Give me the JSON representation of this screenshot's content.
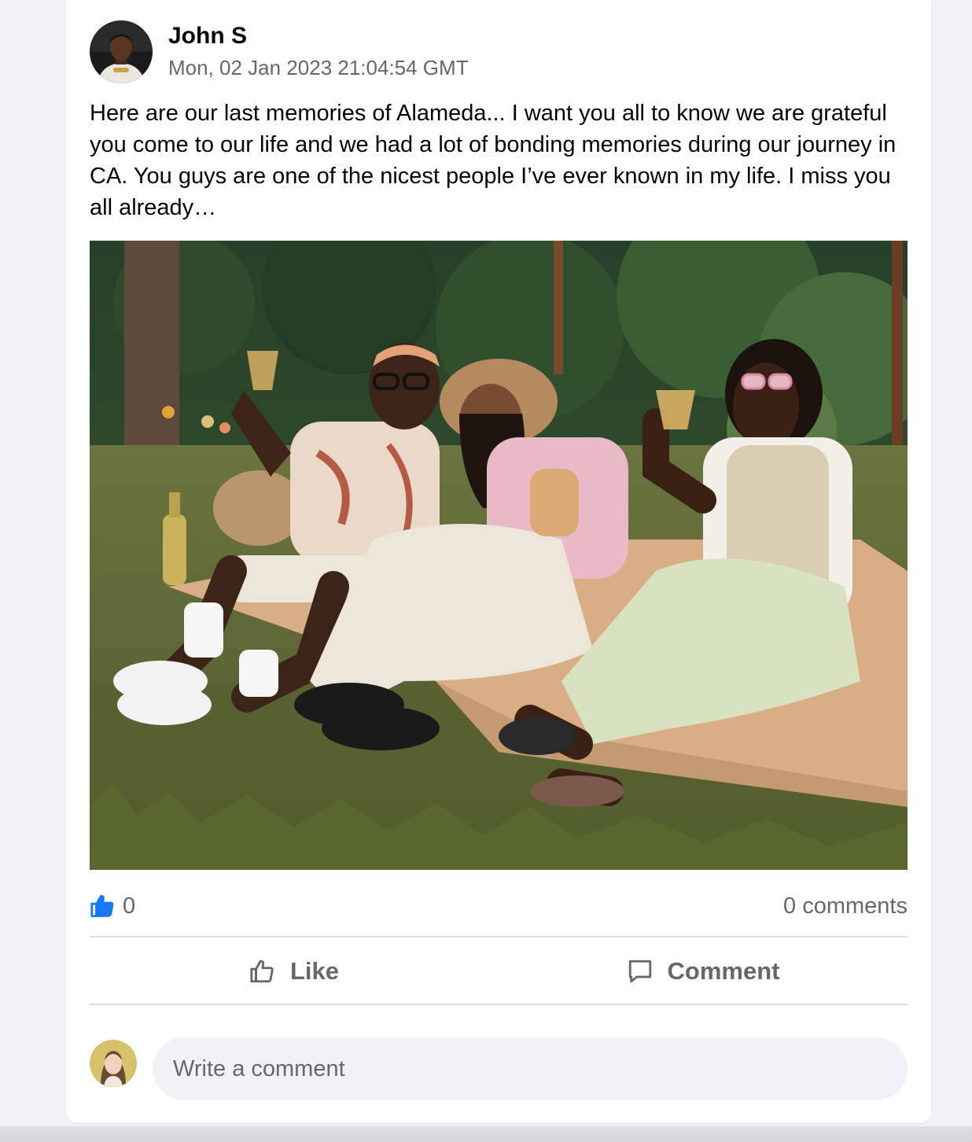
{
  "post": {
    "author": "John S",
    "timestamp": "Mon, 02 Jan 2023 21:04:54 GMT",
    "text": "Here are our last memories of Alameda... I want you all to know we are grateful you come to our life and we had a lot of bonding memories during our journey in CA. You guys are one of the nicest people I’ve ever known in my life. I miss you all already…",
    "photo_icon": "group-picnic-photo"
  },
  "stats": {
    "like_count": "0",
    "comment_count": "0 comments",
    "like_icon": "thumbs-up-icon"
  },
  "actions": {
    "like_label": "Like",
    "like_icon": "thumbs-up-outline-icon",
    "comment_label": "Comment",
    "comment_icon": "speech-bubble-icon"
  },
  "composer": {
    "placeholder": "Write a comment"
  },
  "colors": {
    "accent": "#1877f2",
    "text_primary": "#050505",
    "text_secondary": "#65676b",
    "input_bg": "#f0f2f5",
    "divider": "#dadde1"
  }
}
